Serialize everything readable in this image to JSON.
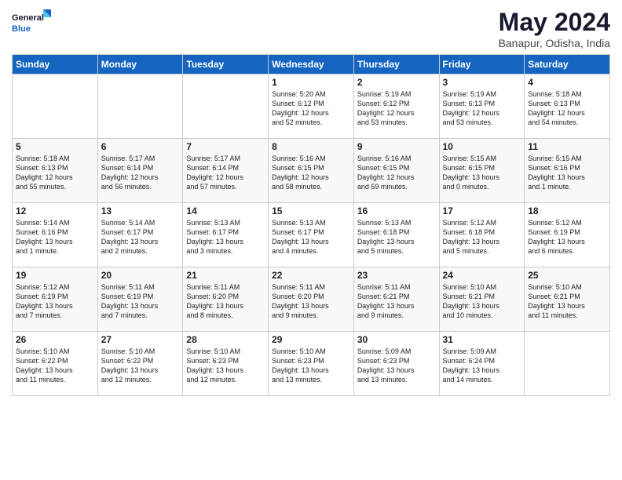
{
  "header": {
    "logo_line1": "General",
    "logo_line2": "Blue",
    "month_title": "May 2024",
    "location": "Banapur, Odisha, India"
  },
  "weekdays": [
    "Sunday",
    "Monday",
    "Tuesday",
    "Wednesday",
    "Thursday",
    "Friday",
    "Saturday"
  ],
  "weeks": [
    [
      {
        "day": "",
        "info": ""
      },
      {
        "day": "",
        "info": ""
      },
      {
        "day": "",
        "info": ""
      },
      {
        "day": "1",
        "info": "Sunrise: 5:20 AM\nSunset: 6:12 PM\nDaylight: 12 hours\nand 52 minutes."
      },
      {
        "day": "2",
        "info": "Sunrise: 5:19 AM\nSunset: 6:12 PM\nDaylight: 12 hours\nand 53 minutes."
      },
      {
        "day": "3",
        "info": "Sunrise: 5:19 AM\nSunset: 6:13 PM\nDaylight: 12 hours\nand 53 minutes."
      },
      {
        "day": "4",
        "info": "Sunrise: 5:18 AM\nSunset: 6:13 PM\nDaylight: 12 hours\nand 54 minutes."
      }
    ],
    [
      {
        "day": "5",
        "info": "Sunrise: 5:18 AM\nSunset: 6:13 PM\nDaylight: 12 hours\nand 55 minutes."
      },
      {
        "day": "6",
        "info": "Sunrise: 5:17 AM\nSunset: 6:14 PM\nDaylight: 12 hours\nand 56 minutes."
      },
      {
        "day": "7",
        "info": "Sunrise: 5:17 AM\nSunset: 6:14 PM\nDaylight: 12 hours\nand 57 minutes."
      },
      {
        "day": "8",
        "info": "Sunrise: 5:16 AM\nSunset: 6:15 PM\nDaylight: 12 hours\nand 58 minutes."
      },
      {
        "day": "9",
        "info": "Sunrise: 5:16 AM\nSunset: 6:15 PM\nDaylight: 12 hours\nand 59 minutes."
      },
      {
        "day": "10",
        "info": "Sunrise: 5:15 AM\nSunset: 6:15 PM\nDaylight: 13 hours\nand 0 minutes."
      },
      {
        "day": "11",
        "info": "Sunrise: 5:15 AM\nSunset: 6:16 PM\nDaylight: 13 hours\nand 1 minute."
      }
    ],
    [
      {
        "day": "12",
        "info": "Sunrise: 5:14 AM\nSunset: 6:16 PM\nDaylight: 13 hours\nand 1 minute."
      },
      {
        "day": "13",
        "info": "Sunrise: 5:14 AM\nSunset: 6:17 PM\nDaylight: 13 hours\nand 2 minutes."
      },
      {
        "day": "14",
        "info": "Sunrise: 5:13 AM\nSunset: 6:17 PM\nDaylight: 13 hours\nand 3 minutes."
      },
      {
        "day": "15",
        "info": "Sunrise: 5:13 AM\nSunset: 6:17 PM\nDaylight: 13 hours\nand 4 minutes."
      },
      {
        "day": "16",
        "info": "Sunrise: 5:13 AM\nSunset: 6:18 PM\nDaylight: 13 hours\nand 5 minutes."
      },
      {
        "day": "17",
        "info": "Sunrise: 5:12 AM\nSunset: 6:18 PM\nDaylight: 13 hours\nand 5 minutes."
      },
      {
        "day": "18",
        "info": "Sunrise: 5:12 AM\nSunset: 6:19 PM\nDaylight: 13 hours\nand 6 minutes."
      }
    ],
    [
      {
        "day": "19",
        "info": "Sunrise: 5:12 AM\nSunset: 6:19 PM\nDaylight: 13 hours\nand 7 minutes."
      },
      {
        "day": "20",
        "info": "Sunrise: 5:11 AM\nSunset: 6:19 PM\nDaylight: 13 hours\nand 7 minutes."
      },
      {
        "day": "21",
        "info": "Sunrise: 5:11 AM\nSunset: 6:20 PM\nDaylight: 13 hours\nand 8 minutes."
      },
      {
        "day": "22",
        "info": "Sunrise: 5:11 AM\nSunset: 6:20 PM\nDaylight: 13 hours\nand 9 minutes."
      },
      {
        "day": "23",
        "info": "Sunrise: 5:11 AM\nSunset: 6:21 PM\nDaylight: 13 hours\nand 9 minutes."
      },
      {
        "day": "24",
        "info": "Sunrise: 5:10 AM\nSunset: 6:21 PM\nDaylight: 13 hours\nand 10 minutes."
      },
      {
        "day": "25",
        "info": "Sunrise: 5:10 AM\nSunset: 6:21 PM\nDaylight: 13 hours\nand 11 minutes."
      }
    ],
    [
      {
        "day": "26",
        "info": "Sunrise: 5:10 AM\nSunset: 6:22 PM\nDaylight: 13 hours\nand 11 minutes."
      },
      {
        "day": "27",
        "info": "Sunrise: 5:10 AM\nSunset: 6:22 PM\nDaylight: 13 hours\nand 12 minutes."
      },
      {
        "day": "28",
        "info": "Sunrise: 5:10 AM\nSunset: 6:23 PM\nDaylight: 13 hours\nand 12 minutes."
      },
      {
        "day": "29",
        "info": "Sunrise: 5:10 AM\nSunset: 6:23 PM\nDaylight: 13 hours\nand 13 minutes."
      },
      {
        "day": "30",
        "info": "Sunrise: 5:09 AM\nSunset: 6:23 PM\nDaylight: 13 hours\nand 13 minutes."
      },
      {
        "day": "31",
        "info": "Sunrise: 5:09 AM\nSunset: 6:24 PM\nDaylight: 13 hours\nand 14 minutes."
      },
      {
        "day": "",
        "info": ""
      }
    ]
  ]
}
